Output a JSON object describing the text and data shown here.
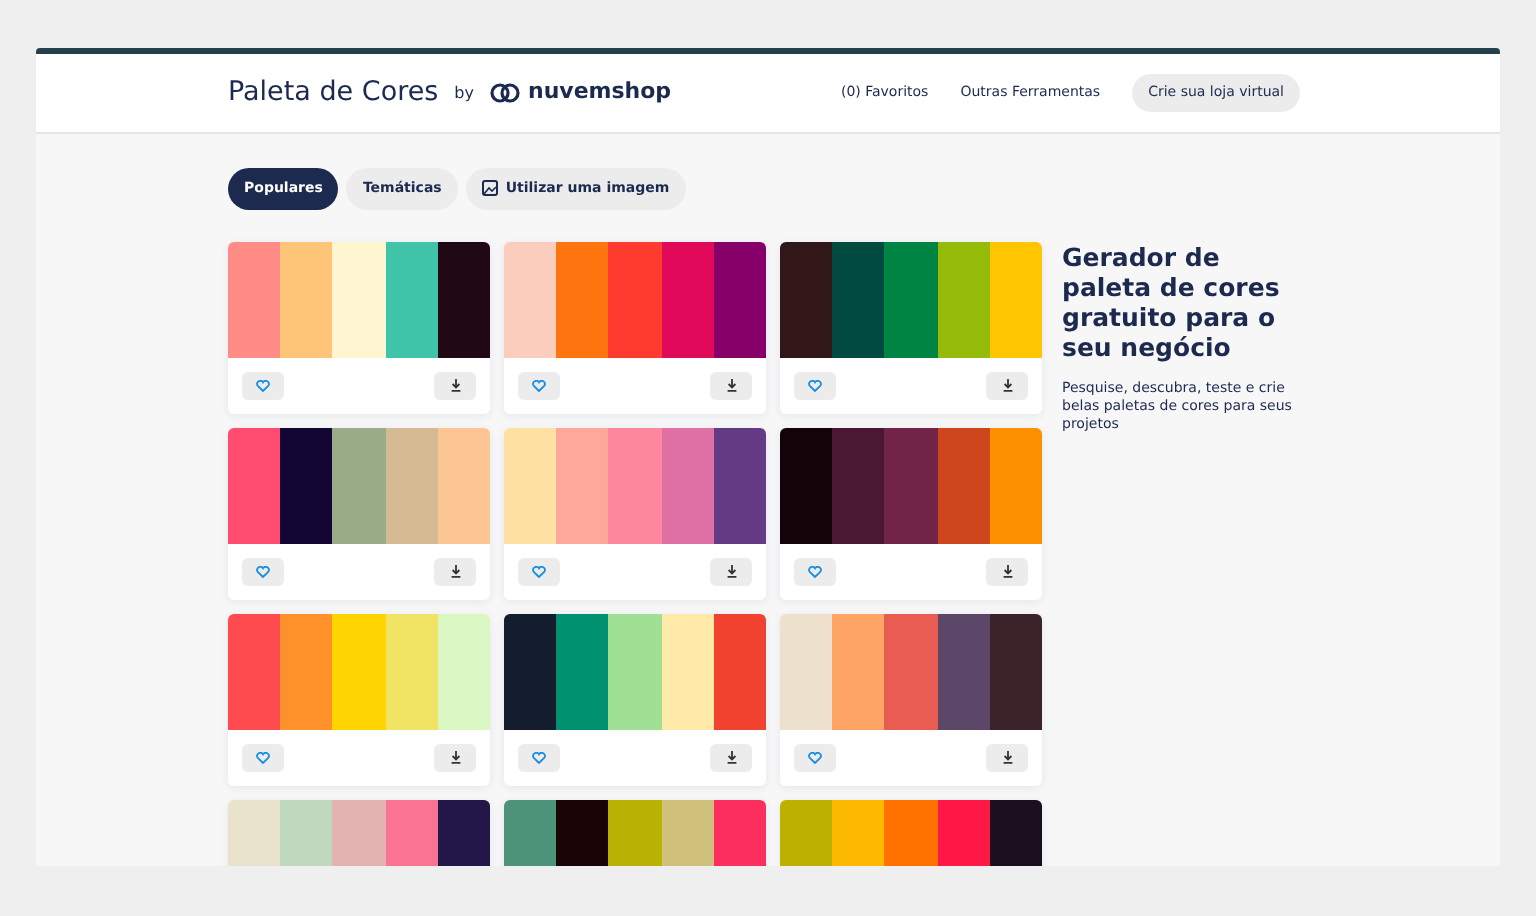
{
  "header": {
    "title": "Paleta de Cores",
    "by": "by",
    "brand": "nuvemshop",
    "links": [
      "(0) Favoritos",
      "Outras Ferramentas"
    ],
    "cta": "Crie sua loja virtual"
  },
  "tabs": [
    {
      "label": "Populares",
      "selected": true,
      "icon": false
    },
    {
      "label": "Temáticas",
      "selected": false,
      "icon": false
    },
    {
      "label": "Utilizar uma imagem",
      "selected": false,
      "icon": true
    }
  ],
  "palettes": [
    {
      "swatches": [
        {
          "color": "#ff8c87"
        },
        {
          "color": "#fec578"
        },
        {
          "color": "#fdf6d0"
        },
        {
          "color": "#40c4a9"
        },
        {
          "color": "#210815"
        }
      ]
    },
    {
      "swatches": [
        {
          "color": "#fbcdbd"
        },
        {
          "color": "#fe7510"
        },
        {
          "color": "#ff3b30"
        },
        {
          "color": "#e0095a"
        },
        {
          "color": "#87006a"
        }
      ]
    },
    {
      "swatches": [
        {
          "color": "#311718"
        },
        {
          "color": "#014a40"
        },
        {
          "color": "#008443"
        },
        {
          "color": "#94bb09"
        },
        {
          "color": "#fec500"
        }
      ]
    },
    {
      "swatches": [
        {
          "color": "#fe4b70"
        },
        {
          "color": "#130534"
        },
        {
          "color": "#9aac87"
        },
        {
          "color": "#d5bb93"
        },
        {
          "color": "#fec594"
        }
      ]
    },
    {
      "swatches": [
        {
          "color": "#fee0a3"
        },
        {
          "color": "#fea89b"
        },
        {
          "color": "#fd879c"
        },
        {
          "color": "#df71a4"
        },
        {
          "color": "#643a85"
        }
      ]
    },
    {
      "swatches": [
        {
          "color": "#120408"
        },
        {
          "color": "#4b1833"
        },
        {
          "color": "#722449"
        },
        {
          "color": "#cd461d"
        },
        {
          "color": "#fd9000"
        }
      ]
    },
    {
      "swatches": [
        {
          "color": "#fe4b50"
        },
        {
          "color": "#fe9129"
        },
        {
          "color": "#fed500"
        },
        {
          "color": "#f1e465"
        },
        {
          "color": "#d9f6c3"
        }
      ]
    },
    {
      "swatches": [
        {
          "color": "#141d2e"
        },
        {
          "color": "#009171"
        },
        {
          "color": "#a0e095"
        },
        {
          "color": "#ffe9a9"
        },
        {
          "color": "#f14230"
        }
      ]
    },
    {
      "swatches": [
        {
          "color": "#ede1cd"
        },
        {
          "color": "#fea565"
        },
        {
          "color": "#e85c51"
        },
        {
          "color": "#5c4768"
        },
        {
          "color": "#3c2329"
        }
      ]
    },
    {
      "swatches": [
        {
          "color": "#e9e2cc"
        },
        {
          "color": "#bfd9bf"
        },
        {
          "color": "#e2b3b0"
        },
        {
          "color": "#fb7393"
        },
        {
          "color": "#231748"
        }
      ]
    },
    {
      "swatches": [
        {
          "color": "#4d937a"
        },
        {
          "color": "#1b0406"
        },
        {
          "color": "#b9b202"
        },
        {
          "color": "#cfc07c"
        },
        {
          "color": "#fc2e5e"
        }
      ]
    },
    {
      "swatches": [
        {
          "color": "#bdb000"
        },
        {
          "color": "#fdb800"
        },
        {
          "color": "#ff7200"
        },
        {
          "color": "#ff1745"
        },
        {
          "color": "#190f1f"
        }
      ]
    }
  ],
  "aside": {
    "heading": "Gerador de paleta de cores gratuito para o seu negócio",
    "text": "Pesquise, descubra, teste e crie belas paletas de cores para seus projetos"
  }
}
